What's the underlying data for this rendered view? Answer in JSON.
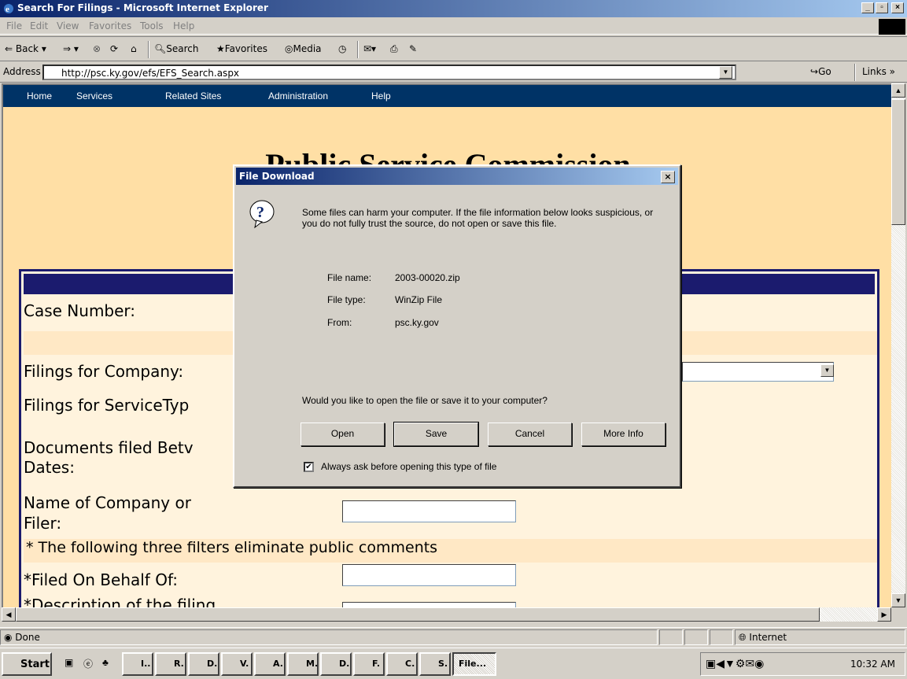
{
  "window": {
    "title": "Search For Filings - Microsoft Internet Explorer",
    "minimize": "_",
    "maximize": "▫",
    "close": "×"
  },
  "menu": [
    "File",
    "Edit",
    "View",
    "Favorites",
    "Tools",
    "Help"
  ],
  "toolbar": {
    "back": "Back",
    "search": "Search",
    "favorites": "Favorites",
    "media": "Media"
  },
  "address": {
    "label": "Address",
    "url": "http://psc.ky.gov/efs/EFS_Search.aspx",
    "go": "Go",
    "links": "Links"
  },
  "site_nav": [
    "Home",
    "Services",
    "Related Sites",
    "Administration",
    "Help"
  ],
  "page": {
    "heading": "Public Service Commission",
    "form": {
      "case_number": "Case Number:",
      "company": "Filings for Company:",
      "service_type": "Filings for ServiceTyp",
      "documents_between": "Documents filed Betv",
      "dates": "Dates:",
      "name_company": "Name of Company or",
      "filer": "Filer:",
      "filters_note": "* The following three filters eliminate public comments",
      "filed_on_behalf": "*Filed On Behalf Of:",
      "description": "*Description of the filing"
    }
  },
  "dialog": {
    "title": "File Download",
    "close": "×",
    "warning": "Some files can harm your computer. If the file information below looks suspicious, or you do not fully trust the source, do not open or save this file.",
    "file_name_label": "File name:",
    "file_name": "2003-00020.zip",
    "file_type_label": "File type:",
    "file_type": "WinZip File",
    "from_label": "From:",
    "from": "psc.ky.gov",
    "question": "Would you like to open the file or save it to your computer?",
    "buttons": {
      "open": "Open",
      "save": "Save",
      "cancel": "Cancel",
      "more_info": "More Info"
    },
    "always_ask": "Always ask before opening this type of file",
    "always_ask_checked": true
  },
  "status": {
    "text": "Done",
    "zone": "Internet"
  },
  "taskbar": {
    "start": "Start",
    "items": [
      "I..",
      "R.",
      "D.",
      "V.",
      "A.",
      "M.",
      "D.",
      "F.",
      "C.",
      "S.",
      "File..."
    ],
    "clock": "10:32 AM"
  }
}
